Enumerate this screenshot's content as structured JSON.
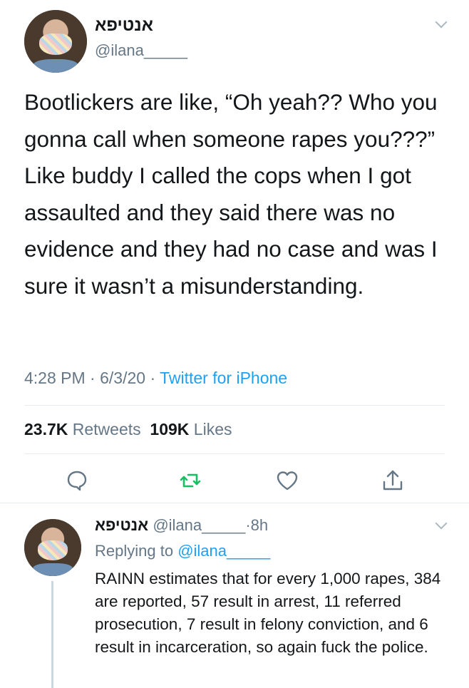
{
  "tweet": {
    "display_name": "אנטיפא",
    "handle": "@ilana_____",
    "text": "Bootlickers are like, “Oh yeah?? Who you gonna call when someone rapes you???” Like buddy I called the cops when I got assaulted and they said there was no evidence and they had no case and was I sure it wasn’t a misunderstanding.",
    "time": "4:28 PM",
    "date": "6/3/20",
    "separator": "·",
    "source": "Twitter for iPhone",
    "retweets_count": "23.7K",
    "retweets_label": "Retweets",
    "likes_count": "109K",
    "likes_label": "Likes"
  },
  "actions": {
    "reply_icon": "reply-icon",
    "retweet_icon": "retweet-icon",
    "like_icon": "heart-icon",
    "share_icon": "share-icon",
    "retweet_color": "#17bf63"
  },
  "reply": {
    "display_name": "אנטיפא",
    "handle": "@ilana_____",
    "separator": "·",
    "age": "8h",
    "replying_label": "Replying to",
    "replying_to": "@ilana_____",
    "text": "RAINN estimates that for every 1,000 rapes, 384 are reported, 57 result in arrest, 11 referred prosecution, 7 result in felony conviction, and 6 result in incarceration, so again fuck the police."
  },
  "colors": {
    "text": "#14171a",
    "secondary": "#657786",
    "link": "#1da1f2",
    "divider": "#e6ecf0"
  }
}
